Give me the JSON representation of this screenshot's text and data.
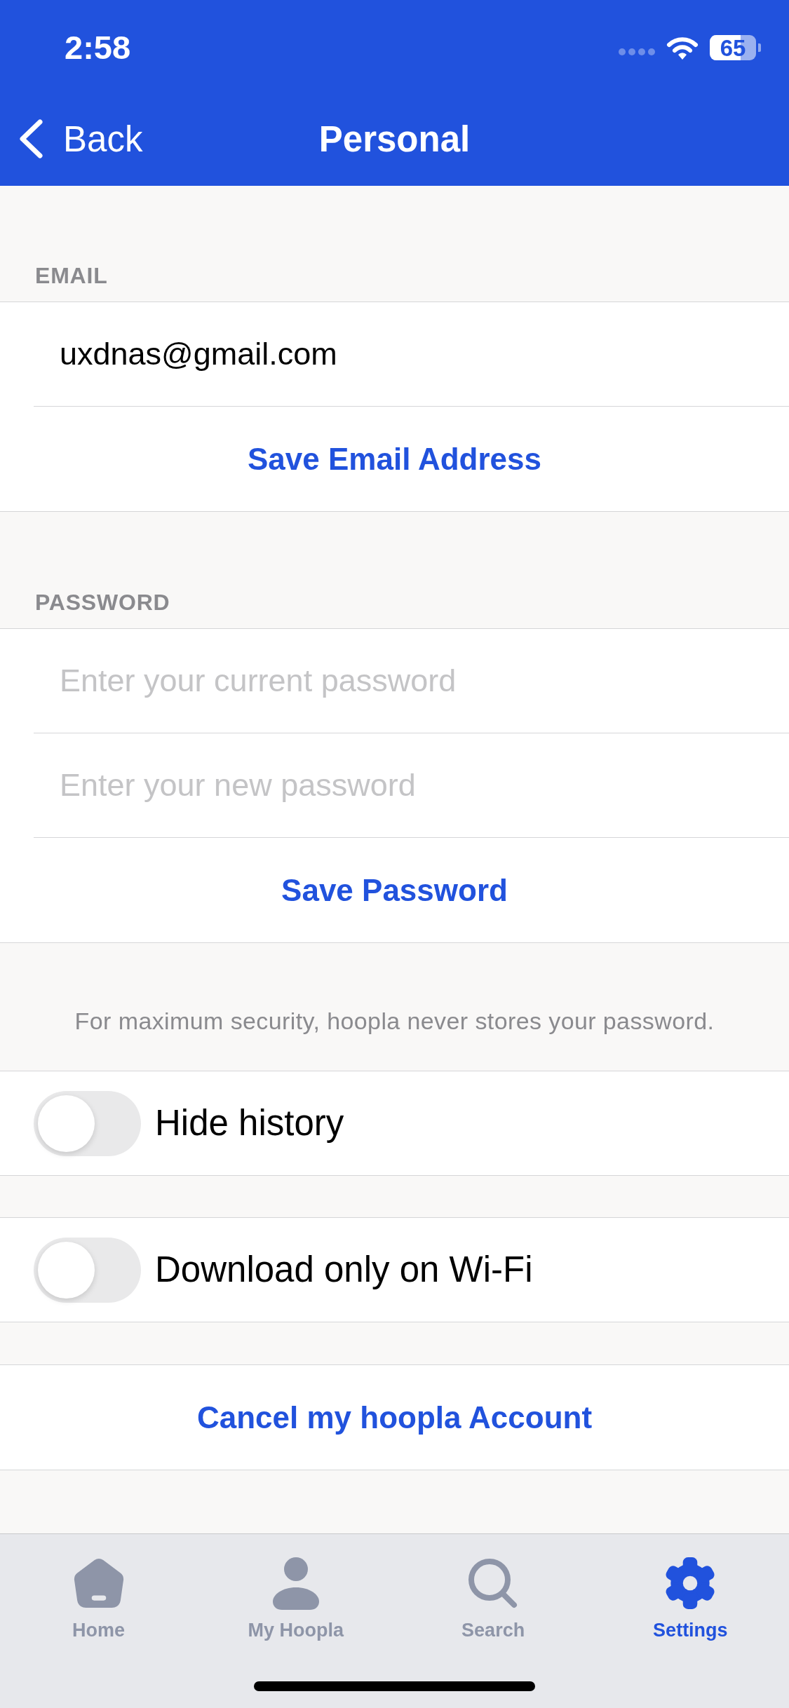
{
  "status_bar": {
    "time": "2:58",
    "battery": "65"
  },
  "nav_bar": {
    "back": "Back",
    "title": "Personal"
  },
  "email_section": {
    "header": "EMAIL",
    "field": {
      "value": "uxdnas@gmail.com"
    },
    "button": "Save Email Address"
  },
  "password_section": {
    "header": "PASSWORD",
    "fields": [
      {
        "placeholder": "Enter your current password"
      },
      {
        "placeholder": "Enter your new password"
      }
    ],
    "button": "Save Password",
    "note": "For maximum security, hoopla never stores your password."
  },
  "toggles": [
    {
      "label": "Hide history",
      "on": false
    },
    {
      "label": "Download only on Wi-Fi",
      "on": false
    }
  ],
  "cancel_button": "Cancel my hoopla Account",
  "tab_bar": [
    {
      "label": "Home",
      "selected": false
    },
    {
      "label": "My Hoopla",
      "selected": false
    },
    {
      "label": "Search",
      "selected": false
    },
    {
      "label": "Settings",
      "selected": true
    }
  ]
}
